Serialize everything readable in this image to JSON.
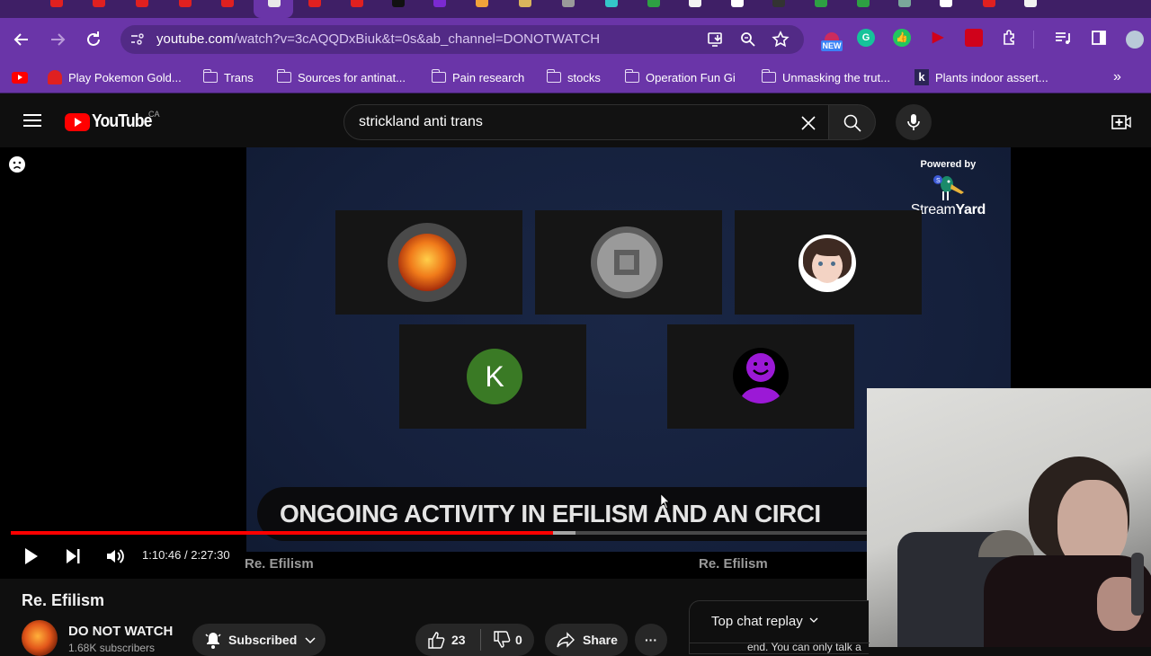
{
  "browser": {
    "active_tab_index": 5,
    "tab_icon_colors": [
      "#e02020",
      "#e02020",
      "#e02020",
      "#e02020",
      "#e02020",
      "#e8e8e8",
      "#e02020",
      "#e02020",
      "#111111",
      "#7b2ad1",
      "#f1a33a",
      "#d9b45c",
      "#9a9a9a",
      "#34c6c8",
      "#2ea043",
      "#f2f2f2",
      "#ffffff",
      "#333333",
      "#2ea043",
      "#2ea043",
      "#7aa79a",
      "#ffffff",
      "#e02020",
      "#f2f2f2"
    ],
    "url_host": "youtube.com",
    "url_rest": "/watch?v=3cAQQDxBiuk&t=0s&ab_channel=DONOTWATCH",
    "nav": {
      "back": "back-arrow",
      "forward": "forward-arrow",
      "reload": "reload"
    },
    "omnibox_icons": [
      "install-app-icon",
      "zoom-icon",
      "bookmark-star-icon"
    ],
    "extensions": [
      {
        "name": "new-badge-extension",
        "label": "NEW",
        "color": "#3b82f6"
      },
      {
        "name": "grammarly-extension",
        "label": "G",
        "color": "#15c39a"
      },
      {
        "name": "thumbs-up-extension",
        "label": "",
        "color": "#22c55e"
      },
      {
        "name": "return-dislike-extension",
        "label": "",
        "color": "#d0021b"
      },
      {
        "name": "chat-extension",
        "label": "",
        "color": "#d0021b"
      },
      {
        "name": "extensions-puzzle",
        "label": "",
        "color": "#6a35a8"
      }
    ],
    "bookmarks": [
      {
        "label": "",
        "icon": "youtube"
      },
      {
        "label": "Play Pokemon Gold...",
        "icon": "ghost"
      },
      {
        "label": "Trans",
        "icon": "folder"
      },
      {
        "label": "Sources for antinat...",
        "icon": "folder"
      },
      {
        "label": "Pain research",
        "icon": "folder"
      },
      {
        "label": "stocks",
        "icon": "folder"
      },
      {
        "label": "Operation Fun Gi",
        "icon": "folder"
      },
      {
        "label": "Unmasking the trut...",
        "icon": "folder"
      },
      {
        "label": "Plants indoor assert...",
        "icon": "k"
      }
    ],
    "bookmarks_overflow": "»"
  },
  "youtube": {
    "logo_text": "YouTube",
    "country_code": "CA",
    "search": {
      "value": "strickland anti trans",
      "placeholder": "Search"
    },
    "player": {
      "current_time": "1:10:46",
      "duration": "2:27:30",
      "time_display": "1:10:46 / 2:27:30",
      "played_fraction": 0.48,
      "buffered_fraction": 0.5,
      "stream_overlay": {
        "powered_by": "Powered by",
        "brand_light": "Stream",
        "brand_bold": "Yard",
        "banner_text": "ONGOING ACTIVITY IN EFILISM AND AN CIRCI",
        "watermark": "Re. Efilism",
        "participants": [
          {
            "name": "fire-horse-avatar",
            "type": "image"
          },
          {
            "name": "screen-share-placeholder",
            "type": "icon"
          },
          {
            "name": "cartoon-woman-avatar",
            "type": "image"
          },
          {
            "name": "k-initial-avatar",
            "type": "initial",
            "initial": "K",
            "color": "#3a7a25"
          },
          {
            "name": "purple-smiley-avatar",
            "type": "icon",
            "color": "#9b19d6"
          }
        ]
      }
    },
    "video": {
      "title": "Re. Efilism",
      "channel_name": "DO NOT WATCH",
      "subscribers": "1.68K subscribers",
      "subscribe_label": "Subscribed",
      "likes": "23",
      "dislikes": "0",
      "share_label": "Share",
      "more_label": "···"
    },
    "chat": {
      "title": "Top chat replay",
      "snippet": "end. You can only talk a"
    }
  },
  "colors": {
    "accent": "#ff0000",
    "browser_chrome": "#6a35a8"
  }
}
